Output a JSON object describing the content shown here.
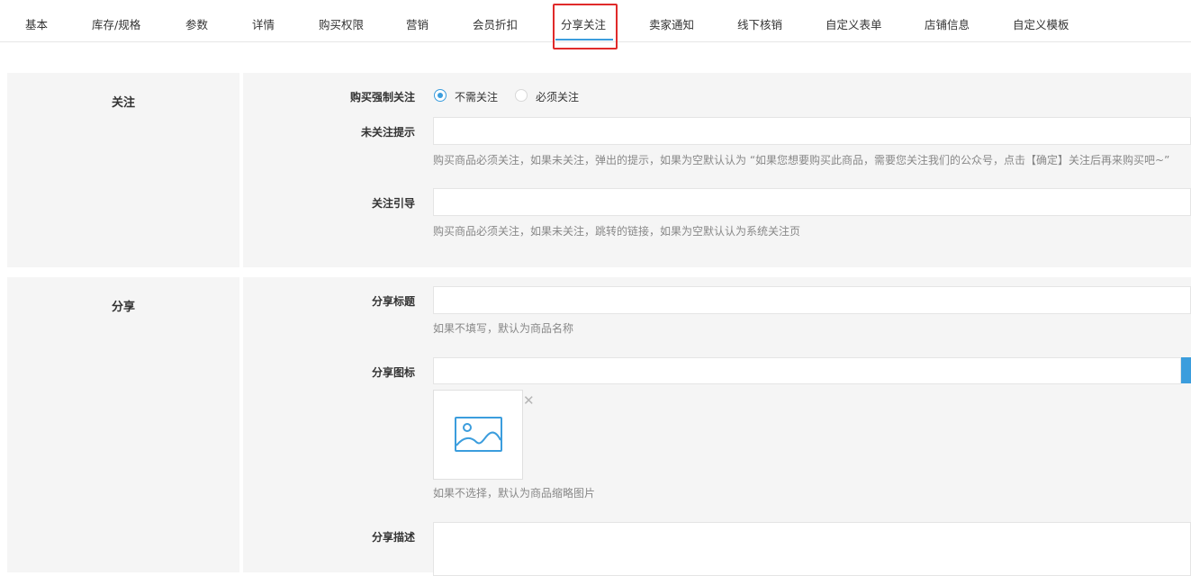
{
  "tabs": [
    {
      "label": "基本"
    },
    {
      "label": "库存/规格"
    },
    {
      "label": "参数"
    },
    {
      "label": "详情"
    },
    {
      "label": "购买权限"
    },
    {
      "label": "营销"
    },
    {
      "label": "会员折扣"
    },
    {
      "label": "分享关注",
      "active": true
    },
    {
      "label": "卖家通知"
    },
    {
      "label": "线下核销"
    },
    {
      "label": "自定义表单"
    },
    {
      "label": "店铺信息"
    },
    {
      "label": "自定义模板"
    }
  ],
  "follow": {
    "section_title": "关注",
    "force_follow_label": "购买强制关注",
    "options": [
      {
        "label": "不需关注",
        "checked": true
      },
      {
        "label": "必须关注",
        "checked": false
      }
    ],
    "unfollow_tip_label": "未关注提示",
    "unfollow_tip_value": "",
    "unfollow_tip_help": "购买商品必须关注，如果未关注，弹出的提示，如果为空默认认为 “如果您想要购买此商品，需要您关注我们的公众号，点击【确定】关注后再来购买吧~”",
    "guide_label": "关注引导",
    "guide_value": "",
    "guide_help": "购买商品必须关注，如果未关注，跳转的链接，如果为空默认认为系统关注页"
  },
  "share": {
    "section_title": "分享",
    "title_label": "分享标题",
    "title_value": "",
    "title_help": "如果不填写，默认为商品名称",
    "icon_label": "分享图标",
    "icon_value": "",
    "icon_help": "如果不选择，默认为商品缩略图片",
    "desc_label": "分享描述",
    "desc_value": ""
  },
  "colors": {
    "accent": "#3b9ddd",
    "highlight_border": "#e02a2a",
    "panel_bg": "#f5f5f5"
  },
  "icons": {
    "image_placeholder": "image-placeholder-icon",
    "remove": "close-icon"
  }
}
